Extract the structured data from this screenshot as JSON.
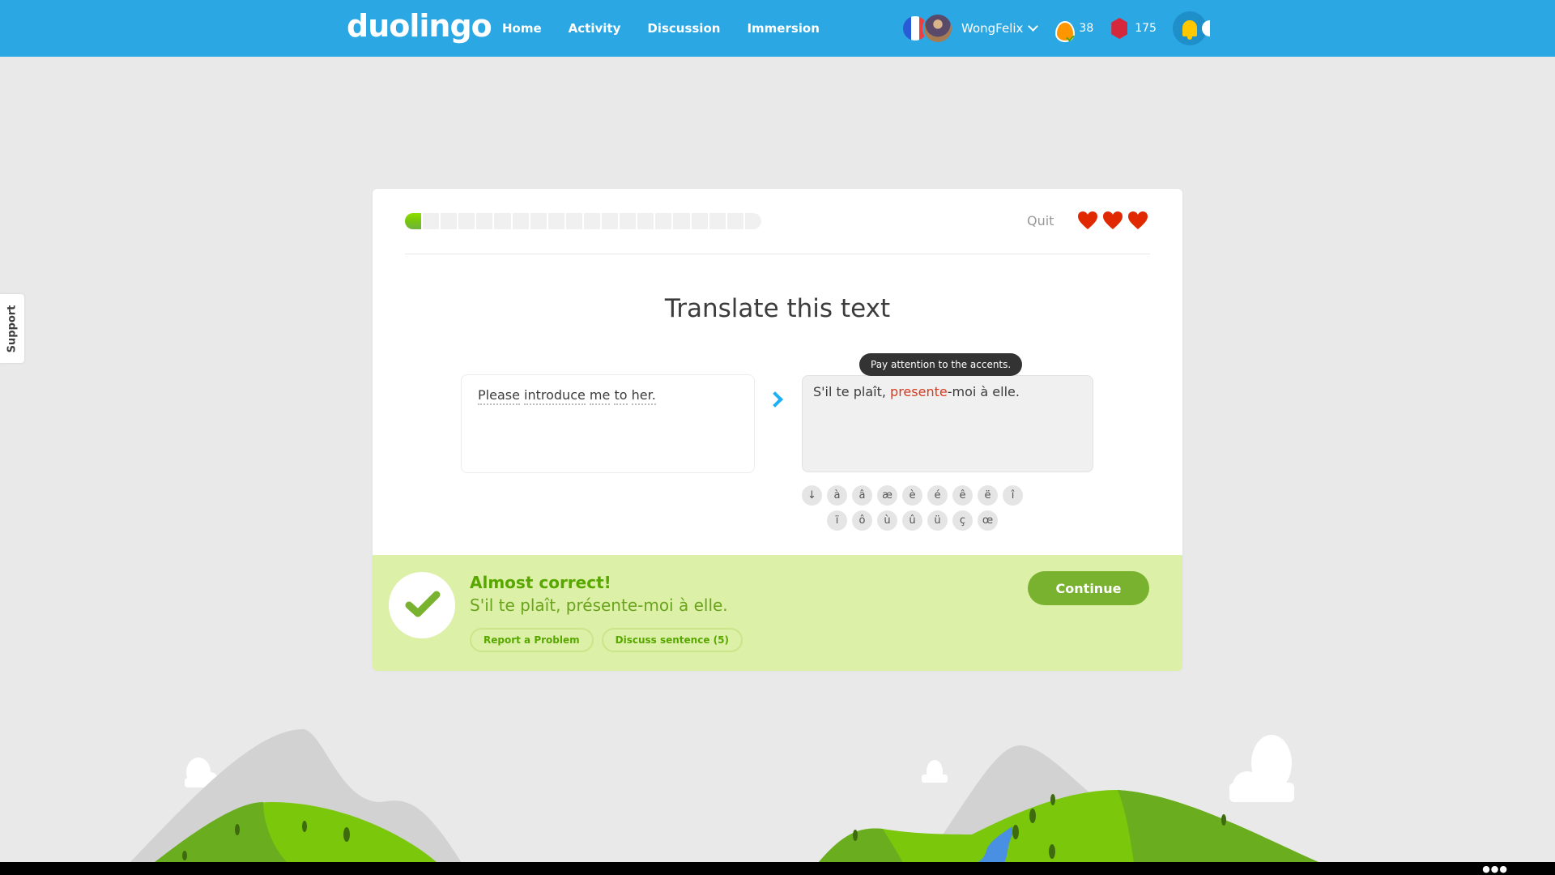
{
  "header": {
    "logo": "duolingo",
    "nav": [
      "Home",
      "Activity",
      "Discussion",
      "Immersion"
    ],
    "username": "WongFelix",
    "streak": "38",
    "gems": "175",
    "icons": {
      "flag": "france-flag-icon",
      "streak": "flame-icon",
      "gems": "gem-icon",
      "notifications": "bell-icon"
    }
  },
  "support": {
    "label": "Support"
  },
  "lesson": {
    "progress": {
      "completed": 1,
      "total": 20
    },
    "quit_label": "Quit",
    "hearts": 3,
    "title": "Translate this text",
    "source_words": [
      "Please",
      "introduce",
      "me",
      "to",
      "her."
    ],
    "answer": {
      "before": "S'il te plaît, ",
      "error": "presente",
      "after": "-moi à elle."
    },
    "tooltip": "Pay attention to the accents.",
    "accent_keys_row1": [
      "↓",
      "à",
      "â",
      "æ",
      "è",
      "é",
      "ê",
      "ë",
      "î"
    ],
    "accent_keys_row2": [
      "ï",
      "ô",
      "ù",
      "û",
      "ü",
      "ç",
      "œ"
    ]
  },
  "feedback": {
    "title": "Almost correct!",
    "correct_answer": "S'il te plaît, présente-moi à elle.",
    "report_label": "Report a Problem",
    "discuss_label": "Discuss sentence (5)",
    "continue_label": "Continue"
  },
  "colors": {
    "topbar": "#2ba7e3",
    "accent_green": "#78b22e",
    "feedback_bg": "#ddf0a8",
    "error_red": "#d9391c",
    "heart_red": "#e02900"
  }
}
